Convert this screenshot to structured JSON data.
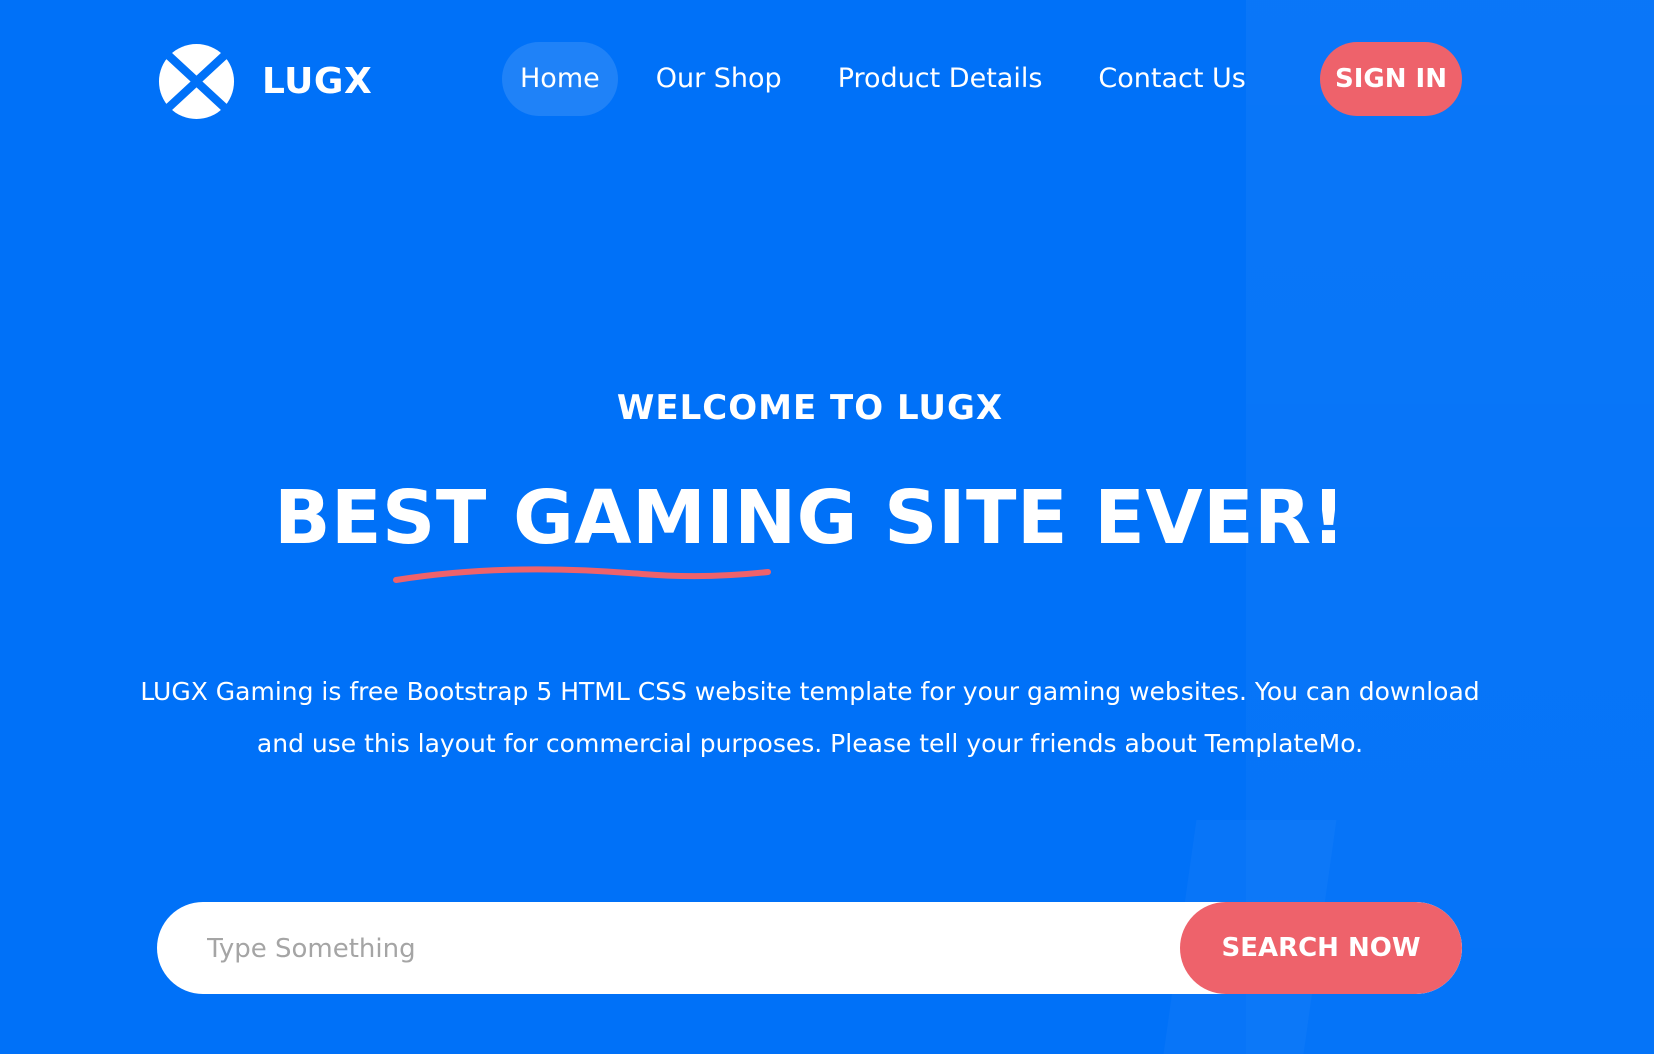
{
  "brand": {
    "name": "LUGX",
    "logo_icon": "lugx-x-logo-icon"
  },
  "nav": {
    "items": [
      {
        "label": "Home",
        "active": true
      },
      {
        "label": "Our Shop",
        "active": false
      },
      {
        "label": "Product Details",
        "active": false
      },
      {
        "label": "Contact Us",
        "active": false
      }
    ],
    "sign_in_label": "SIGN IN"
  },
  "hero": {
    "eyebrow": "WELCOME TO LUGX",
    "title": "BEST GAMING SITE EVER!",
    "description": "LUGX Gaming is free Bootstrap 5 HTML CSS website template for your gaming websites. You can download and use this layout for commercial purposes. Please tell your friends about TemplateMo."
  },
  "search": {
    "placeholder": "Type Something",
    "value": "",
    "button_label": "SEARCH NOW"
  },
  "colors": {
    "background": "#0071f8",
    "accent": "#ee626b",
    "text": "#ffffff"
  }
}
